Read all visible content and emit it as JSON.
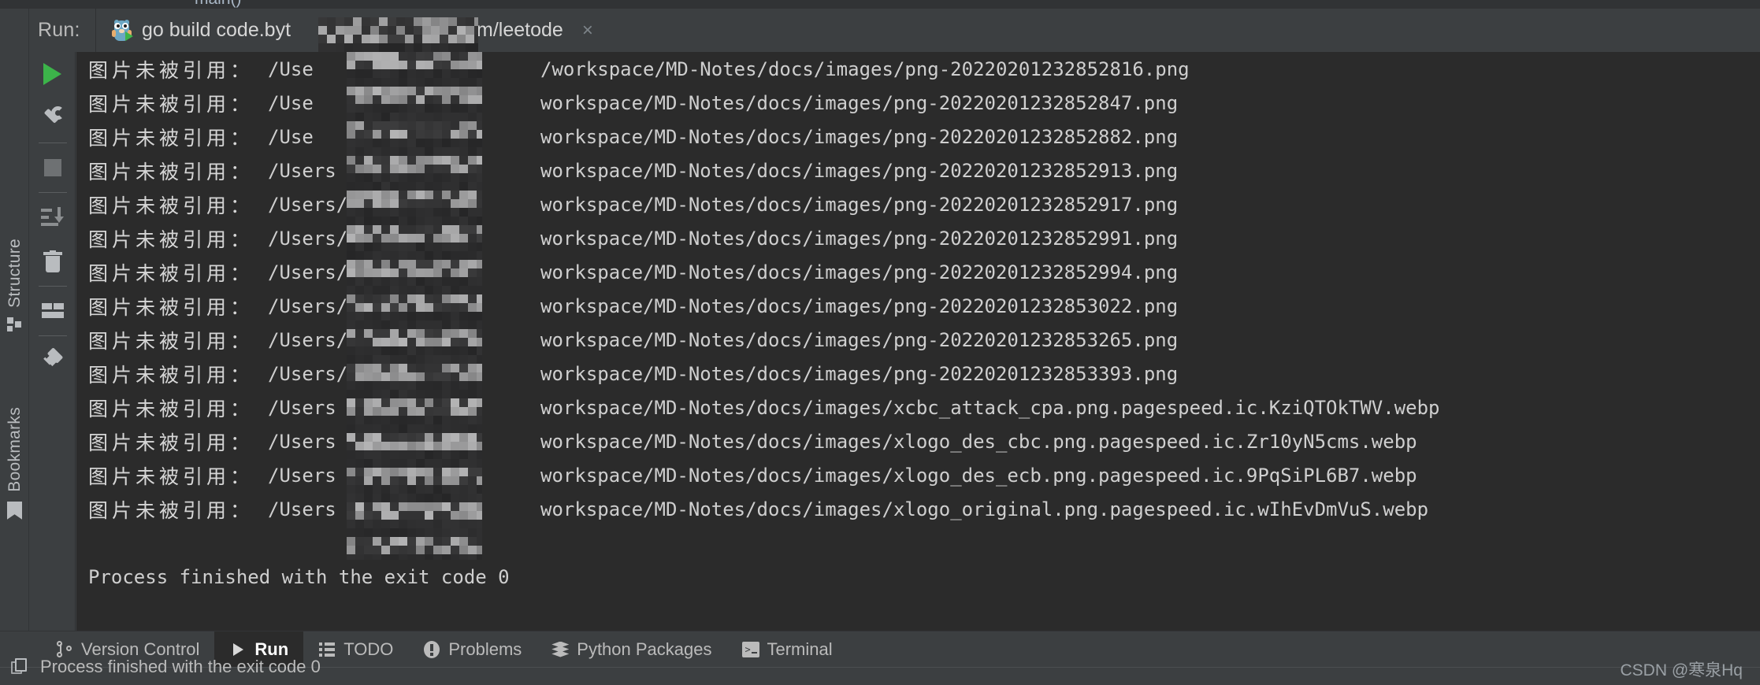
{
  "editor": {
    "breadcrumb": "main()"
  },
  "run_header": {
    "label": "Run:",
    "tab": {
      "icon": "go-gopher-icon",
      "title_visible": "go build code.byt",
      "title_tail": "m/leetode",
      "close_label": "×"
    }
  },
  "left_tool_bars": [
    {
      "name": "structure",
      "label": "Structure",
      "icon": "structure-icon"
    },
    {
      "name": "bookmarks",
      "label": "Bookmarks",
      "icon": "bookmark-icon"
    }
  ],
  "run_toolbar": [
    {
      "name": "rerun",
      "icon": "play-icon"
    },
    {
      "name": "edit-configuration",
      "icon": "wrench-icon"
    },
    {
      "name": "stop",
      "icon": "stop-square-icon"
    },
    {
      "name": "scroll-to-end",
      "icon": "scroll-to-end-icon"
    },
    {
      "name": "clear-all",
      "icon": "trash-icon"
    },
    {
      "name": "layout",
      "icon": "layout-icon"
    },
    {
      "name": "pin-tab",
      "icon": "pin-icon"
    }
  ],
  "console": {
    "prefix": "图片未被引用：",
    "path_head": "/Users",
    "path_tail_prefix": "workspace/MD-Notes/docs/images/",
    "lines": [
      {
        "prefix": "图片未被引用：",
        "head": "/Use",
        "tail": "/workspace/MD-Notes/docs/images/png-20220201232852816.png"
      },
      {
        "prefix": "图片未被引用：",
        "head": "/Use",
        "tail": "workspace/MD-Notes/docs/images/png-20220201232852847.png"
      },
      {
        "prefix": "图片未被引用：",
        "head": "/Use",
        "tail": "workspace/MD-Notes/docs/images/png-20220201232852882.png"
      },
      {
        "prefix": "图片未被引用：",
        "head": "/Users",
        "tail": "workspace/MD-Notes/docs/images/png-20220201232852913.png"
      },
      {
        "prefix": "图片未被引用：",
        "head": "/Users/",
        "tail": "workspace/MD-Notes/docs/images/png-20220201232852917.png"
      },
      {
        "prefix": "图片未被引用：",
        "head": "/Users/",
        "tail": "workspace/MD-Notes/docs/images/png-20220201232852991.png"
      },
      {
        "prefix": "图片未被引用：",
        "head": "/Users/",
        "tail": "workspace/MD-Notes/docs/images/png-20220201232852994.png"
      },
      {
        "prefix": "图片未被引用：",
        "head": "/Users/",
        "tail": "workspace/MD-Notes/docs/images/png-20220201232853022.png"
      },
      {
        "prefix": "图片未被引用：",
        "head": "/Users/",
        "tail": "workspace/MD-Notes/docs/images/png-20220201232853265.png"
      },
      {
        "prefix": "图片未被引用：",
        "head": "/Users/",
        "tail": "workspace/MD-Notes/docs/images/png-20220201232853393.png"
      },
      {
        "prefix": "图片未被引用：",
        "head": "/Users",
        "tail": "workspace/MD-Notes/docs/images/xcbc_attack_cpa.png.pagespeed.ic.KziQTOkTWV.webp"
      },
      {
        "prefix": "图片未被引用：",
        "head": "/Users",
        "tail": "workspace/MD-Notes/docs/images/xlogo_des_cbc.png.pagespeed.ic.Zr10yN5cms.webp"
      },
      {
        "prefix": "图片未被引用：",
        "head": "/Users",
        "tail": "workspace/MD-Notes/docs/images/xlogo_des_ecb.png.pagespeed.ic.9PqSiPL6B7.webp"
      },
      {
        "prefix": "图片未被引用：",
        "head": "/Users",
        "tail": "workspace/MD-Notes/docs/images/xlogo_original.png.pagespeed.ic.wIhEvDmVuS.webp"
      }
    ],
    "finished": "Process finished with the exit code 0"
  },
  "bottom_tabs": [
    {
      "label": "Version Control",
      "icon": "version-control-icon",
      "active": false
    },
    {
      "label": "Run",
      "icon": "play-icon",
      "active": true
    },
    {
      "label": "TODO",
      "icon": "todo-list-icon",
      "active": false
    },
    {
      "label": "Problems",
      "icon": "problems-icon",
      "active": false
    },
    {
      "label": "Python Packages",
      "icon": "stack-layers-icon",
      "active": false
    },
    {
      "label": "Terminal",
      "icon": "terminal-icon",
      "active": false
    }
  ],
  "status_bar": {
    "icon": "copy-icon",
    "message": "Process finished with the exit code 0",
    "watermark": "CSDN @寒泉Hq"
  },
  "colors": {
    "window_bg": "#3c3f41",
    "console_bg": "#2b2b2b",
    "text": "#d6d6d6",
    "muted_text": "#bbbbbb",
    "accent_green": "#3cb44a",
    "tab_underline": "#8a929b"
  }
}
